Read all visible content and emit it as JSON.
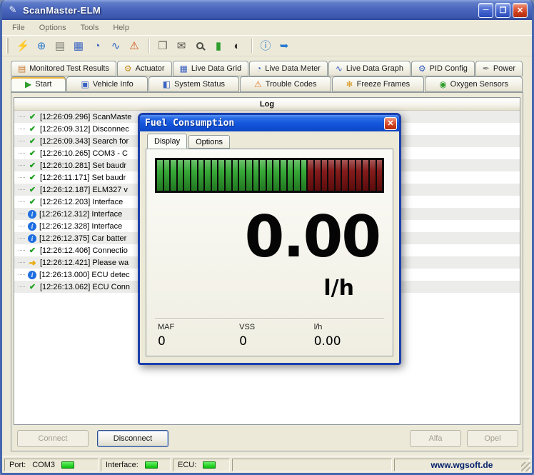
{
  "window": {
    "title": "ScanMaster-ELM",
    "icon": {
      "name": "app-icon",
      "glyph": "✎"
    },
    "controls": [
      {
        "name": "minimize-button",
        "glyph": "─"
      },
      {
        "name": "maximize-button",
        "glyph": "❐"
      },
      {
        "name": "close-button",
        "glyph": "✕"
      }
    ]
  },
  "menu": {
    "items": [
      "File",
      "Options",
      "Tools",
      "Help"
    ]
  },
  "toolbar": {
    "groups": [
      [
        {
          "name": "connect-icon",
          "glyph": "⚡",
          "color": "#3a3a36"
        },
        {
          "name": "website-icon",
          "glyph": "⊕",
          "color": "#2a7ad0"
        },
        {
          "name": "report-icon",
          "glyph": "▤",
          "color": "#7a7a70"
        },
        {
          "name": "live-data-grid-icon",
          "glyph": "▦",
          "color": "#3a62c0"
        },
        {
          "name": "live-data-meter-icon",
          "glyph": "◔",
          "color": "#3a62c0"
        },
        {
          "name": "live-data-graph-icon",
          "glyph": "∿",
          "color": "#2a62c9"
        },
        {
          "name": "trouble-codes-icon",
          "glyph": "⚠",
          "color": "#d05010"
        }
      ],
      [
        {
          "name": "copy-icon",
          "glyph": "❐",
          "color": "#666660"
        },
        {
          "name": "terminal-icon",
          "glyph": "✉",
          "color": "#55554e"
        },
        {
          "name": "search-icon",
          "glyph": "",
          "shape": "magnifier",
          "color": "#4c4c46"
        },
        {
          "name": "battery-icon",
          "glyph": "▮",
          "color": "#2e9e2e"
        },
        {
          "name": "night-mode-icon",
          "glyph": "◐",
          "color": "#33332f"
        }
      ],
      [
        {
          "name": "info-icon",
          "glyph": "ⓘ",
          "color": "#2a7ad0"
        },
        {
          "name": "exit-icon",
          "glyph": "➥",
          "color": "#2a7ad0"
        }
      ]
    ]
  },
  "tabs": {
    "top": [
      {
        "label": "Monitored Test Results",
        "icon": "clipboard-icon",
        "glyph": "▤",
        "color": "#c87830",
        "active": false
      },
      {
        "label": "Actuator",
        "icon": "actuator-icon",
        "glyph": "⚙",
        "color": "#c89020",
        "active": false
      },
      {
        "label": "Live Data Grid",
        "icon": "grid-icon",
        "glyph": "▦",
        "color": "#3a62c0",
        "active": false
      },
      {
        "label": "Live Data Meter",
        "icon": "meter-icon",
        "glyph": "◔",
        "color": "#3a62c0",
        "active": false
      },
      {
        "label": "Live Data Graph",
        "icon": "graph-icon",
        "glyph": "∿",
        "color": "#3a62c0",
        "active": false
      },
      {
        "label": "PID Config",
        "icon": "config-icon",
        "glyph": "⚙",
        "color": "#3a62c0",
        "active": false
      },
      {
        "label": "Power",
        "icon": "power-icon",
        "glyph": "✒",
        "color": "#8a8a86",
        "active": false
      }
    ],
    "bottom": [
      {
        "label": "Start",
        "icon": "start-icon",
        "glyph": "▶",
        "color": "#2e9e2e",
        "active": true
      },
      {
        "label": "Vehicle Info",
        "icon": "vehicle-icon",
        "glyph": "▣",
        "color": "#3a62c0",
        "active": false
      },
      {
        "label": "System Status",
        "icon": "system-status-icon",
        "glyph": "◧",
        "color": "#3a62c0",
        "active": false
      },
      {
        "label": "Trouble Codes",
        "icon": "warning-icon",
        "glyph": "⚠",
        "color": "#e07820",
        "active": false
      },
      {
        "label": "Freeze Frames",
        "icon": "freeze-icon",
        "glyph": "❄",
        "color": "#d49010",
        "active": false
      },
      {
        "label": "Oxygen Sensors",
        "icon": "oxygen-icon",
        "glyph": "◉",
        "color": "#2e9e2e",
        "active": false
      }
    ]
  },
  "log": {
    "header": "Log",
    "entries": [
      {
        "icon": "check",
        "time": "[12:26:09.296]",
        "text": "ScanMaste"
      },
      {
        "icon": "check",
        "time": "[12:26:09.312]",
        "text": "Disconnec"
      },
      {
        "icon": "check",
        "time": "[12:26:09.343]",
        "text": "Search for"
      },
      {
        "icon": "check",
        "time": "[12:26:10.265]",
        "text": "COM3 - C"
      },
      {
        "icon": "check",
        "time": "[12:26:10.281]",
        "text": "Set baudr"
      },
      {
        "icon": "check",
        "time": "[12:26:11.171]",
        "text": "Set baudr"
      },
      {
        "icon": "check",
        "time": "[12:26:12.187]",
        "text": "ELM327 v"
      },
      {
        "icon": "check",
        "time": "[12:26:12.203]",
        "text": "Interface"
      },
      {
        "icon": "info",
        "time": "[12:26:12.312]",
        "text": "Interface"
      },
      {
        "icon": "info",
        "time": "[12:26:12.328]",
        "text": "Interface"
      },
      {
        "icon": "info",
        "time": "[12:26:12.375]",
        "text": "Car batter"
      },
      {
        "icon": "check",
        "time": "[12:26:12.406]",
        "text": "Connectio"
      },
      {
        "icon": "arrow",
        "time": "[12:26:12.421]",
        "text": "Please wa"
      },
      {
        "icon": "info",
        "time": "[12:26:13.000]",
        "text": "ECU detec"
      },
      {
        "icon": "check",
        "time": "[12:26:13.062]",
        "text": "ECU Conn"
      }
    ]
  },
  "dialog": {
    "title": "Fuel Consumption",
    "close_glyph": "✕",
    "tabs": [
      {
        "label": "Display",
        "active": true
      },
      {
        "label": "Options",
        "active": false
      }
    ],
    "gauge": {
      "segments": 33,
      "green_count": 22,
      "green_color": "#2da52d",
      "red_color": "#7e1010"
    },
    "value": "0.00",
    "unit": "l/h",
    "readouts": [
      {
        "label": "MAF",
        "value": "0"
      },
      {
        "label": "VSS",
        "value": "0"
      },
      {
        "label": "l/h",
        "value": "0.00"
      }
    ]
  },
  "actions": {
    "connect": "Connect",
    "disconnect": "Disconnect",
    "alfa": "Alfa",
    "opel": "Opel"
  },
  "statusbar": {
    "port_label": "Port:",
    "port_value": "COM3",
    "interface_label": "Interface:",
    "ecu_label": "ECU:",
    "website": "www.wgsoft.de"
  }
}
